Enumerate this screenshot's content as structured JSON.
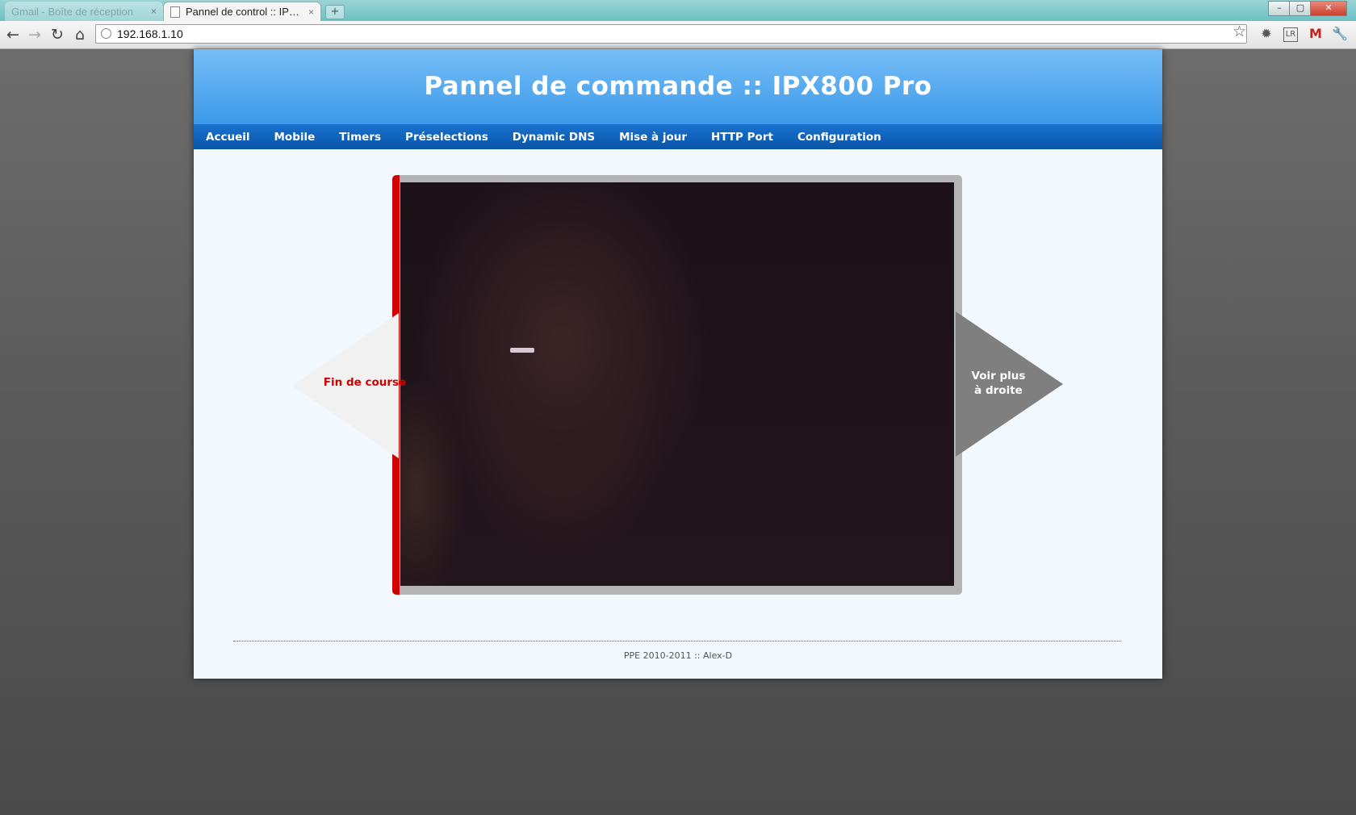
{
  "browser": {
    "tabs": [
      {
        "title": "Gmail - Boîte de réception",
        "active": false
      },
      {
        "title": "Pannel de control :: IPX80...",
        "active": true
      }
    ],
    "tab_close": "×",
    "new_tab": "+",
    "address": "192.168.1.10",
    "window_controls": {
      "minimize": "–",
      "maximize": "▢",
      "close": "✕"
    },
    "nav_icons": {
      "back": "←",
      "forward": "→",
      "reload": "↻",
      "home": "⌂",
      "star": "☆"
    },
    "extension_icons": [
      "gear-icon",
      "lastpass-icon",
      "gmail-icon",
      "wrench-icon"
    ]
  },
  "header": {
    "title": "Pannel de commande :: IPX800 Pro"
  },
  "menu": {
    "items": [
      "Accueil",
      "Mobile",
      "Timers",
      "Préselections",
      "Dynamic DNS",
      "Mise à jour",
      "HTTP Port",
      "Configuration"
    ]
  },
  "viewer": {
    "left_arrow_label": "Fin de course",
    "right_arrow_line1": "Voir plus",
    "right_arrow_line2": "à droite"
  },
  "footer": {
    "text": "PPE 2010-2011 :: Alex-D"
  },
  "colors": {
    "header_top": "#76bdf6",
    "menu_bg": "#0854a8",
    "limit_red": "#d10000",
    "right_arrow": "#7f7f7f"
  }
}
